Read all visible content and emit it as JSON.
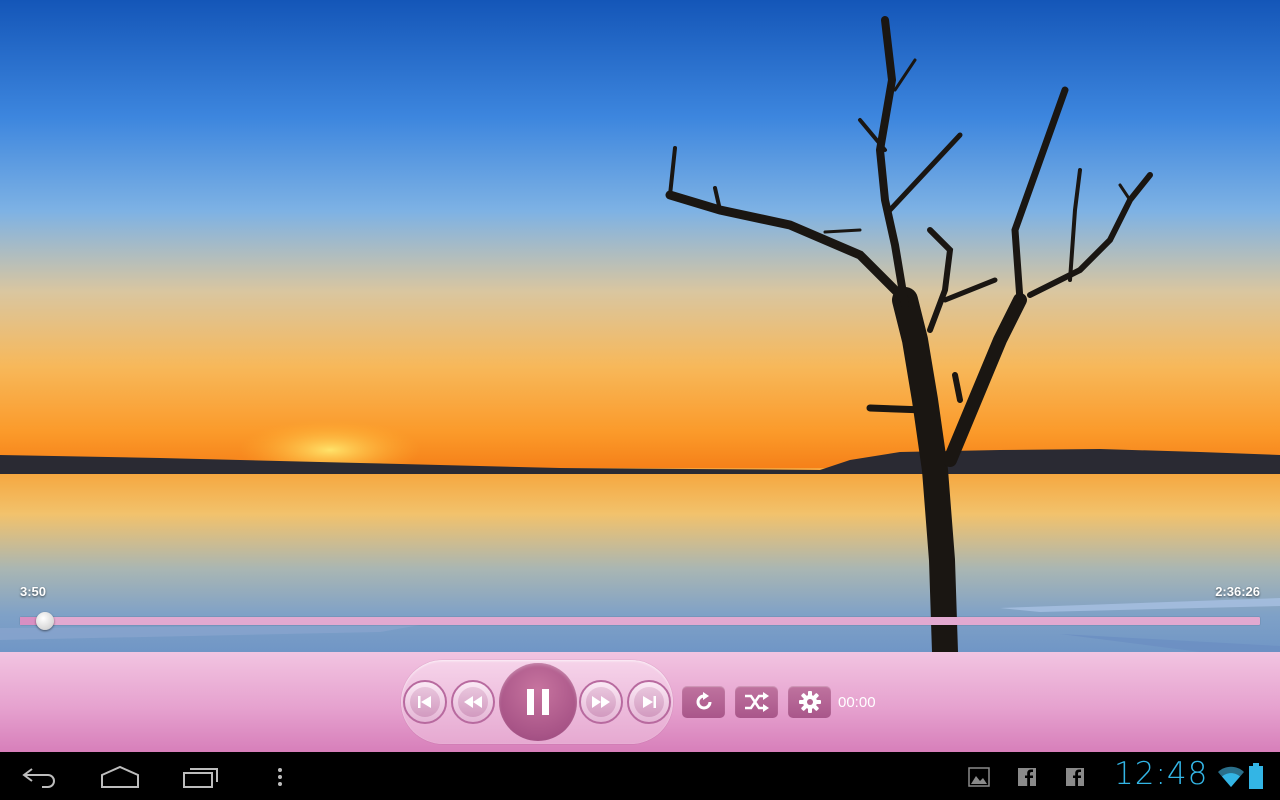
{
  "player": {
    "elapsed": "3:50",
    "duration": "2:36:26",
    "progress": 0.02,
    "counter": "00:00"
  },
  "controls": {
    "icons": [
      "skip-previous-icon",
      "rewind-icon",
      "pause-icon",
      "fast-forward-icon",
      "skip-next-icon",
      "repeat-icon",
      "shuffle-icon",
      "settings-icon"
    ],
    "accent": "#a85487",
    "bar_color": "#e6a2cf"
  },
  "navbar": {
    "icons": [
      "back-icon",
      "home-icon",
      "recent-apps-icon",
      "menu-icon",
      "gallery-notification-icon",
      "facebook-notification-icon",
      "facebook-notification-icon",
      "wifi-icon",
      "battery-icon"
    ],
    "clock": "12:48",
    "clock_color": "#33b5e5"
  }
}
